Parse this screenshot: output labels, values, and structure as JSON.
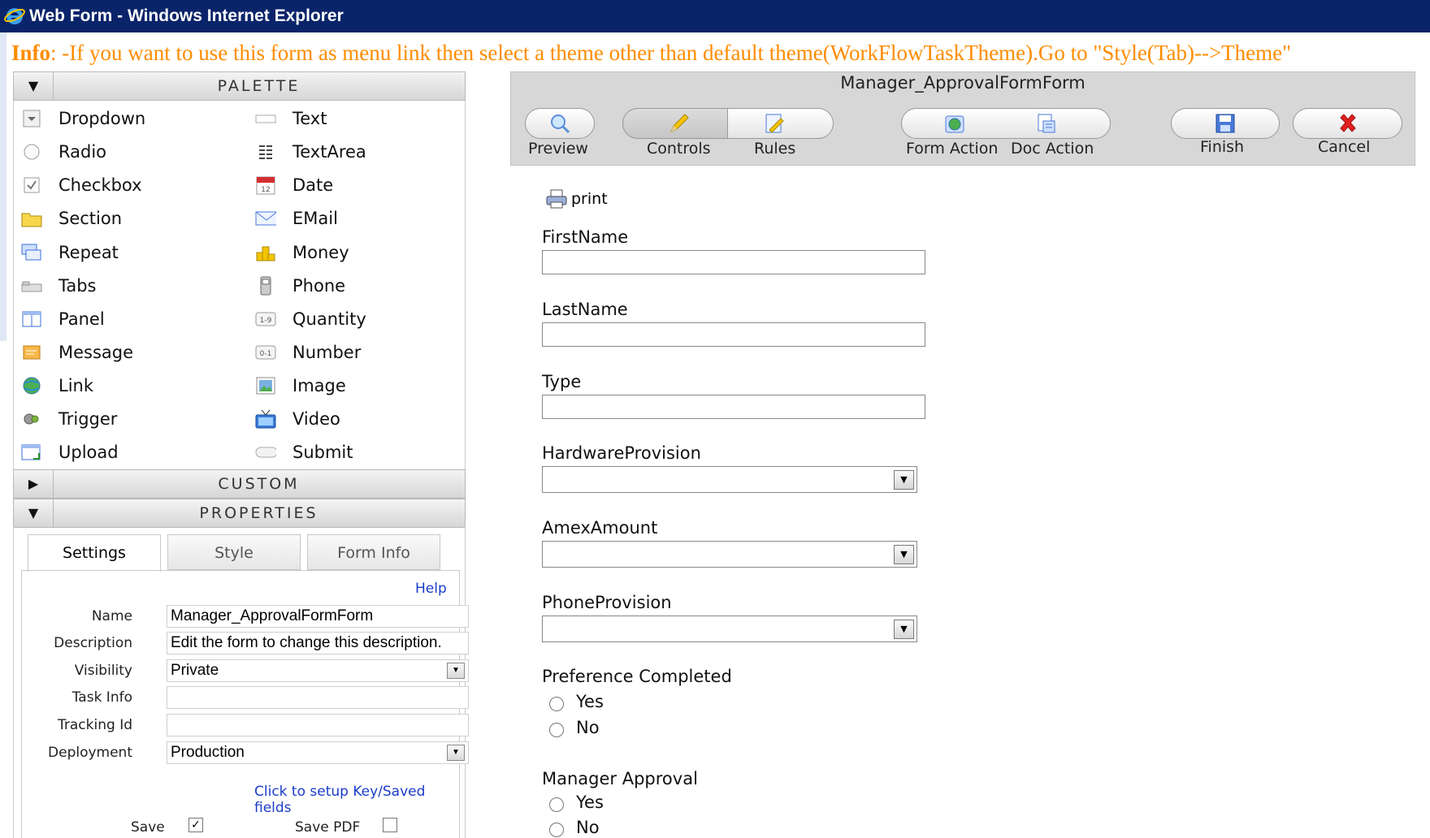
{
  "window": {
    "title": "Web Form - Windows Internet Explorer"
  },
  "info": {
    "label": "Info",
    "text": ": -If you want to use this form as menu link then select a theme other than default theme(WorkFlowTaskTheme).Go to \"Style(Tab)-->Theme\""
  },
  "palette": {
    "header": "PALETTE",
    "left_items": [
      {
        "label": "Dropdown",
        "icon": "dropdown-icon"
      },
      {
        "label": "Radio",
        "icon": "radio-icon"
      },
      {
        "label": "Checkbox",
        "icon": "checkbox-icon"
      },
      {
        "label": "Section",
        "icon": "folder-icon"
      },
      {
        "label": "Repeat",
        "icon": "repeat-icon"
      },
      {
        "label": "Tabs",
        "icon": "tabs-icon"
      },
      {
        "label": "Panel",
        "icon": "panel-icon"
      },
      {
        "label": "Message",
        "icon": "message-icon"
      },
      {
        "label": "Link",
        "icon": "globe-link-icon"
      },
      {
        "label": "Trigger",
        "icon": "trigger-icon"
      },
      {
        "label": "Upload",
        "icon": "upload-icon"
      }
    ],
    "right_items": [
      {
        "label": "Text",
        "icon": "text-field-icon"
      },
      {
        "label": "TextArea",
        "icon": "textarea-icon"
      },
      {
        "label": "Date",
        "icon": "calendar-icon",
        "icon_text": "12"
      },
      {
        "label": "EMail",
        "icon": "envelope-icon"
      },
      {
        "label": "Money",
        "icon": "coins-icon"
      },
      {
        "label": "Phone",
        "icon": "phone-icon"
      },
      {
        "label": "Quantity",
        "icon": "quantity-icon",
        "icon_text": "1-9"
      },
      {
        "label": "Number",
        "icon": "number-icon",
        "icon_text": "0-1"
      },
      {
        "label": "Image",
        "icon": "image-icon"
      },
      {
        "label": "Video",
        "icon": "tv-icon"
      },
      {
        "label": "Submit",
        "icon": "submit-icon"
      }
    ]
  },
  "custom": {
    "header": "CUSTOM"
  },
  "properties": {
    "header": "PROPERTIES",
    "tabs": [
      "Settings",
      "Style",
      "Form Info"
    ],
    "active_tab": "Settings",
    "help_link": "Help",
    "fields": {
      "name": {
        "label": "Name",
        "value": "Manager_ApprovalFormForm"
      },
      "description": {
        "label": "Description",
        "value": "Edit the form to change this description."
      },
      "visibility": {
        "label": "Visibility",
        "value": "Private"
      },
      "task_info": {
        "label": "Task Info",
        "value": ""
      },
      "tracking_id": {
        "label": "Tracking Id",
        "value": ""
      },
      "deployment": {
        "label": "Deployment",
        "value": "Production"
      }
    },
    "key_link": "Click to setup Key/Saved fields",
    "save_label": "Save",
    "save_checked": true,
    "save_pdf_label": "Save PDF",
    "save_pdf_checked": false
  },
  "toolbar": {
    "form_title": "Manager_ApprovalFormForm",
    "buttons": [
      {
        "label": "Preview",
        "icon": "magnifier-icon"
      },
      {
        "label": "Controls",
        "icon": "pencil-icon"
      },
      {
        "label": "Rules",
        "icon": "rules-icon"
      },
      {
        "label": "Form Action",
        "icon": "globe-icon"
      },
      {
        "label": "Doc Action",
        "icon": "document-icon"
      },
      {
        "label": "Finish",
        "icon": "save-disk-icon"
      },
      {
        "label": "Cancel",
        "icon": "red-x-icon"
      }
    ]
  },
  "form": {
    "print_label": "print",
    "first_name": {
      "label": "FirstName",
      "value": ""
    },
    "last_name": {
      "label": "LastName",
      "value": ""
    },
    "type": {
      "label": "Type",
      "value": ""
    },
    "hardware_provision": {
      "label": "HardwareProvision",
      "value": ""
    },
    "amex_amount": {
      "label": "AmexAmount",
      "value": ""
    },
    "phone_provision": {
      "label": "PhoneProvision",
      "value": ""
    },
    "preference_completed": {
      "label": "Preference Completed",
      "options": [
        "Yes",
        "No"
      ]
    },
    "manager_approval": {
      "label": "Manager Approval",
      "options": [
        "Yes",
        "No"
      ]
    }
  },
  "colors": {
    "titlebar": "#0a246a",
    "info_text": "#ff8c00",
    "link": "#1a3cc8",
    "cancel_x": "#e02020"
  }
}
